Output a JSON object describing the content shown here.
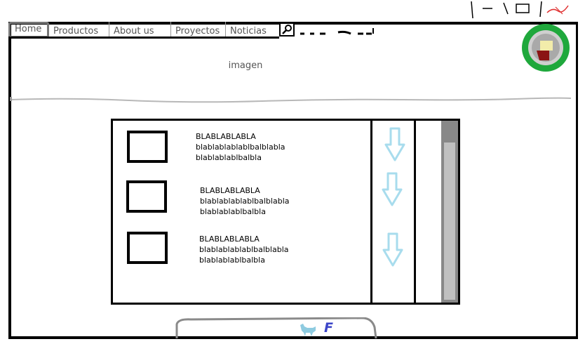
{
  "nav": {
    "tabs": [
      {
        "label": "Home"
      },
      {
        "label": "Productos"
      },
      {
        "label": "About us"
      },
      {
        "label": "Proyectos"
      },
      {
        "label": "Noticias"
      }
    ]
  },
  "hero": {
    "label": "imagen"
  },
  "items": [
    {
      "title": "BLABLABLABLA",
      "line1": "blablablablablbalblabla",
      "line2": "blablablablbalbla"
    },
    {
      "title": "BLABLABLABLA",
      "line1": "blablablablablbalblabla",
      "line2": "blablablablbalbla"
    },
    {
      "title": "BLABLABLABLA",
      "line1": "blablablablablbalblabla",
      "line2": "blablablablbalbla"
    }
  ],
  "footer": {
    "letter": "F"
  },
  "icons": {
    "search": "search-icon",
    "arrow": "arrow-down-icon",
    "avatar": "avatar-icon",
    "bird": "bird-icon",
    "minimize": "minimize-icon",
    "maximize": "maximize-icon",
    "close": "close-icon"
  },
  "colors": {
    "avatar_ring": "#1fa83c",
    "arrow": "#a8dced",
    "footer_letter": "#3c46c8"
  }
}
